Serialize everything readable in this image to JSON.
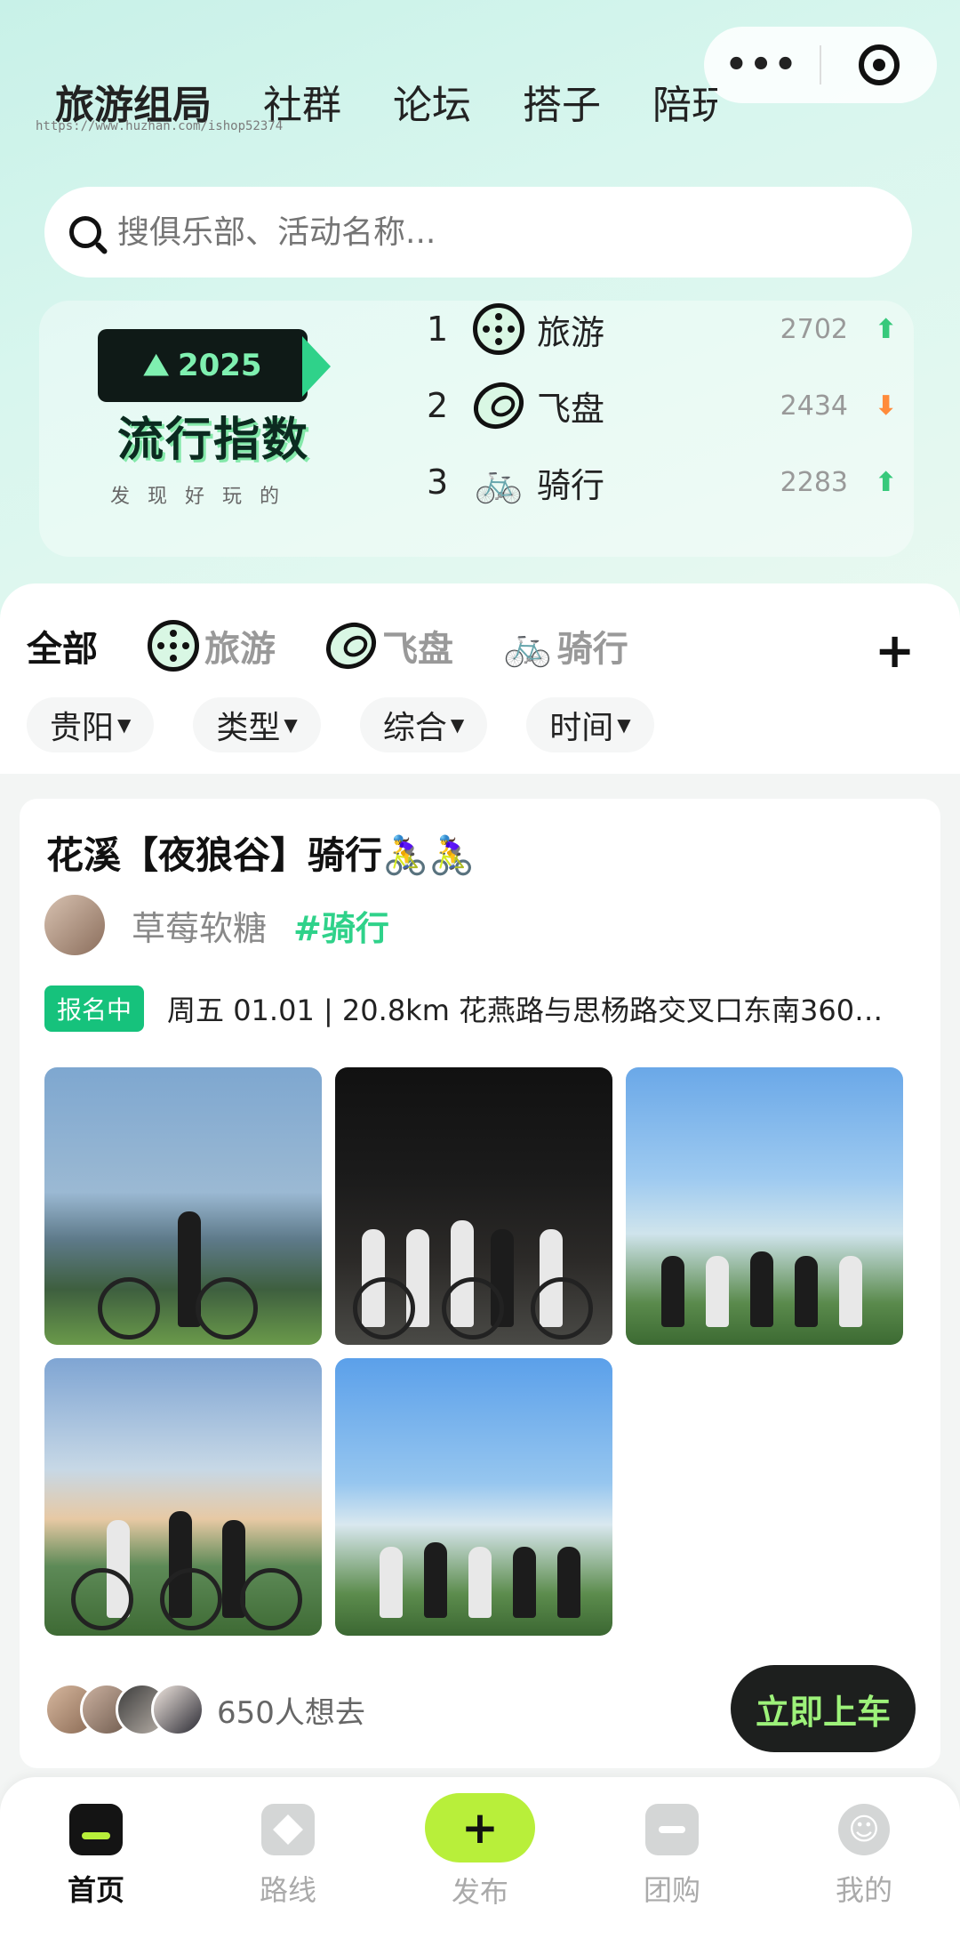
{
  "capsule": {
    "menu": "•••"
  },
  "top_nav": [
    "旅游组局",
    "社群",
    "论坛",
    "搭子",
    "陪玩"
  ],
  "watermark_url": "https://www.huzhan.com/ishop52374",
  "search": {
    "placeholder": "搜俱乐部、活动名称..."
  },
  "trend": {
    "badge_year": "2025",
    "title": "流行指数",
    "subtitle": "发现好玩的",
    "rows": [
      {
        "rank": "1",
        "name": "旅游",
        "score": "2702",
        "dir": "up",
        "icon": "film-reel-icon"
      },
      {
        "rank": "2",
        "name": "飞盘",
        "score": "2434",
        "dir": "down",
        "icon": "frisbee-icon"
      },
      {
        "rank": "3",
        "name": "骑行",
        "score": "2283",
        "dir": "up",
        "icon": "bicycle-icon"
      }
    ]
  },
  "categories": [
    {
      "label": "全部",
      "active": true
    },
    {
      "label": "旅游",
      "icon": "film-reel-icon"
    },
    {
      "label": "飞盘",
      "icon": "frisbee-icon"
    },
    {
      "label": "骑行",
      "icon": "bicycle-icon"
    }
  ],
  "filters": [
    "贵阳",
    "类型",
    "综合",
    "时间"
  ],
  "card": {
    "title": "花溪【夜狼谷】骑行🚴‍♀️🚴‍♀️",
    "author": "草莓软糖",
    "tag": "#骑行",
    "status": "报名中",
    "info": "周五 01.01 | 20.8km 花燕路与思杨路交叉口东南360米…",
    "want_count": "650人想去",
    "action": "立即上车"
  },
  "tabbar": [
    {
      "label": "首页",
      "active": true
    },
    {
      "label": "路线"
    },
    {
      "label": "发布"
    },
    {
      "label": "团购"
    },
    {
      "label": "我的"
    }
  ],
  "colors": {
    "accent": "#b8ef3a",
    "green": "#2fd28a",
    "up": "#37c97b",
    "down": "#ff8b3b"
  }
}
